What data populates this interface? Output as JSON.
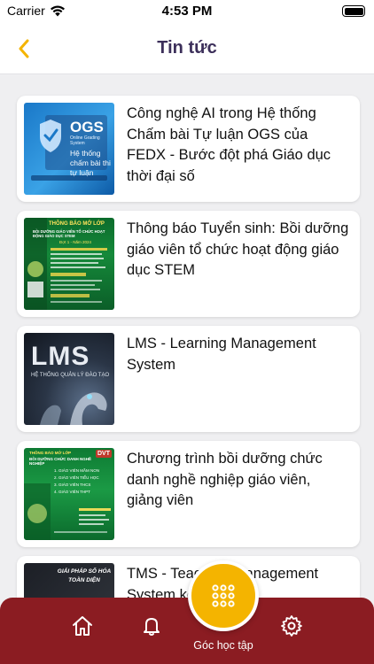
{
  "status_bar": {
    "carrier": "Carrier",
    "time": "4:53 PM"
  },
  "nav": {
    "title": "Tin tức"
  },
  "news": [
    {
      "title": "Công nghệ AI trong Hệ thống Chấm bài Tự luận OGS của FEDX - Bước đột phá Giáo dục thời đại số",
      "thumb_text": [
        "OGS",
        "Online Grading System",
        "Hệ thống",
        "chấm bài thi",
        "tự luận"
      ]
    },
    {
      "title": "Thông báo Tuyển sinh: Bồi dưỡng giáo viên tổ chức hoạt động giáo dục STEM",
      "thumb_text": [
        "THÔNG BÁO MỞ LỚP",
        "BỒI DƯỠNG GIÁO VIÊN TỔ CHỨC HOẠT ĐỘNG GIÁO DỤC STEM",
        "Đợt 1 - Năm 2024"
      ]
    },
    {
      "title": "LMS - Learning Management System",
      "thumb_text": [
        "LMS",
        "HỆ THỐNG QUẢN LÝ ĐÀO TẠO"
      ]
    },
    {
      "title": "Chương trình bồi dưỡng chức danh nghề nghiệp giáo viên, giảng viên",
      "thumb_text": [
        "THÔNG BÁO MỞ LỚP",
        "BỒI DƯỠNG CHỨC DANH NGHỀ NGHIỆP",
        "1. GIÁO VIÊN MẦM NON",
        "2. GIÁO VIÊN TIỂU HỌC",
        "3. GIÁO VIÊN THCS",
        "4. GIÁO VIÊN THPT",
        "DVT"
      ]
    },
    {
      "title": "TMS - Teaching Management System kết hợp A.I",
      "thumb_text": [
        "GIẢI PHÁP SỐ HÓA",
        "TOÀN DIỆN"
      ]
    }
  ],
  "tab_bar": {
    "center_label": "Góc học tập"
  },
  "colors": {
    "accent": "#f4b400",
    "tab_bar": "#8b1c22",
    "title": "#3c2f5a"
  }
}
